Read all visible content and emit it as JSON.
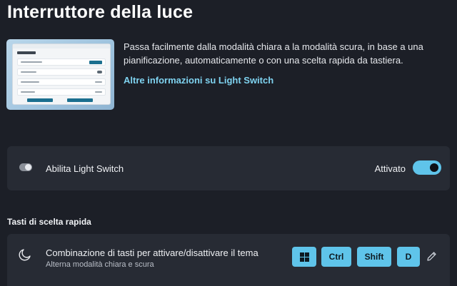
{
  "header": {
    "title": "Interruttore della luce"
  },
  "intro": {
    "description": "Passa facilmente dalla modalità chiara a la modalità scura, in base a una pianificazione, automaticamente o con una scelta rapida da tastiera.",
    "link": "Altre informazioni su Light Switch"
  },
  "enable": {
    "icon": "toggle-icon",
    "label": "Abilita Light Switch",
    "state": "Attivato",
    "enabled": true
  },
  "shortcuts": {
    "section_title": "Tasti di scelta rapida",
    "item": {
      "icon": "moon-icon",
      "label": "Combinazione di tasti per attivare/disattivare il tema",
      "sublabel": "Alterna modalità chiara e scura",
      "keys": [
        "win",
        "Ctrl",
        "Shift",
        "D"
      ],
      "edit_icon": "pencil-icon"
    }
  },
  "colors": {
    "background": "#1c1f27",
    "card": "#272b34",
    "accent": "#5fc4ea",
    "link": "#7fd3f0"
  }
}
